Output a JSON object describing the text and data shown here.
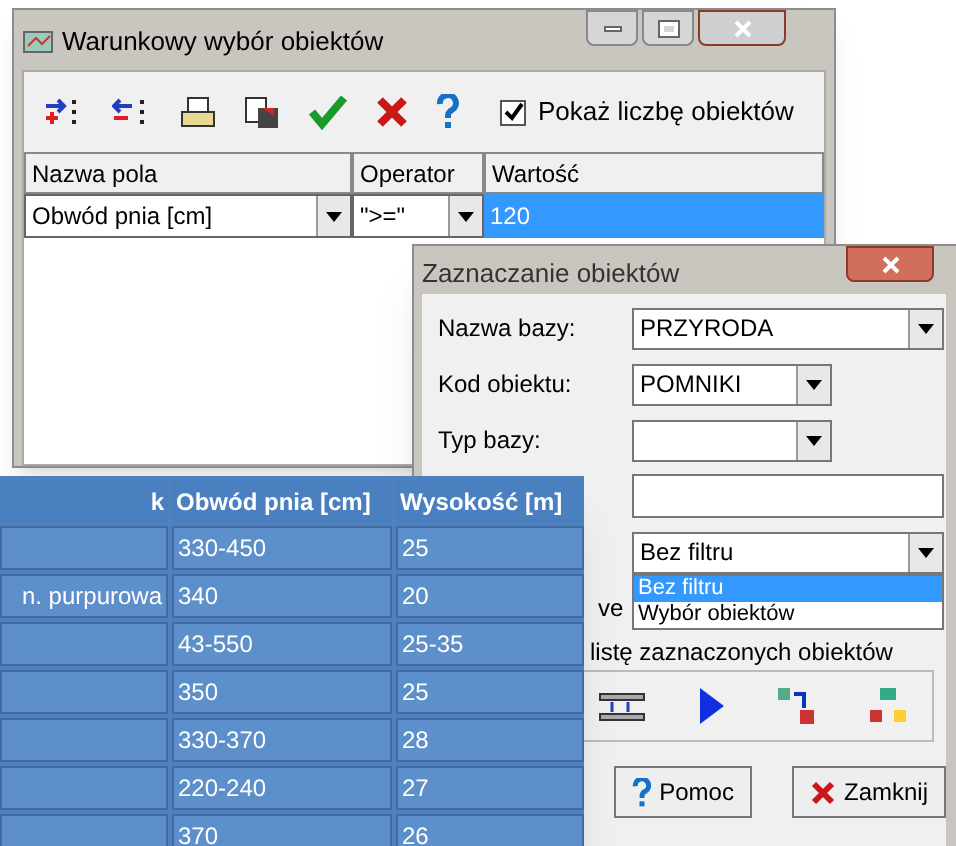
{
  "filter_window": {
    "title": "Warunkowy wybór obiektów",
    "show_count": {
      "label": "Pokaż liczbę obiektów",
      "checked": true
    },
    "columns": [
      "Nazwa pola",
      "Operator",
      "Wartość"
    ],
    "row": {
      "field": "Obwód pnia [cm]",
      "operator": "\">=\"",
      "value": "120"
    }
  },
  "select_window": {
    "title": "Zaznaczanie obiektów",
    "fields": [
      {
        "kind": "combo",
        "label": "Nazwa bazy:",
        "value": "PRZYRODA",
        "wide": true
      },
      {
        "kind": "combo",
        "label": "Kod obiektu:",
        "value": "POMNIKI",
        "wide": false
      },
      {
        "kind": "combo",
        "label": "Typ bazy:",
        "wide": false
      },
      {
        "kind": "text"
      },
      {
        "kind": "combo",
        "value": "Bez filtru",
        "wide": true
      }
    ],
    "dropdown": [
      {
        "label": "Bez filtru",
        "selected": true
      },
      {
        "label": "Wybór obiektów",
        "selected": false
      }
    ],
    "partial_text": "ve",
    "list_text": "listę zaznaczonych obiektów",
    "buttons": [
      "Pomoc",
      "Zamknij"
    ]
  },
  "table": {
    "columns": [
      "k",
      "Obwód pnia [cm]",
      "Wysokość [m]"
    ],
    "rows": [
      [
        "",
        "330-450",
        "25"
      ],
      [
        "n. purpurowa",
        "340",
        "20"
      ],
      [
        "",
        "43-550",
        "25-35"
      ],
      [
        "",
        "350",
        "25"
      ],
      [
        "",
        "330-370",
        "28"
      ],
      [
        "",
        "220-240",
        "27"
      ],
      [
        "",
        "370",
        "26"
      ]
    ]
  }
}
